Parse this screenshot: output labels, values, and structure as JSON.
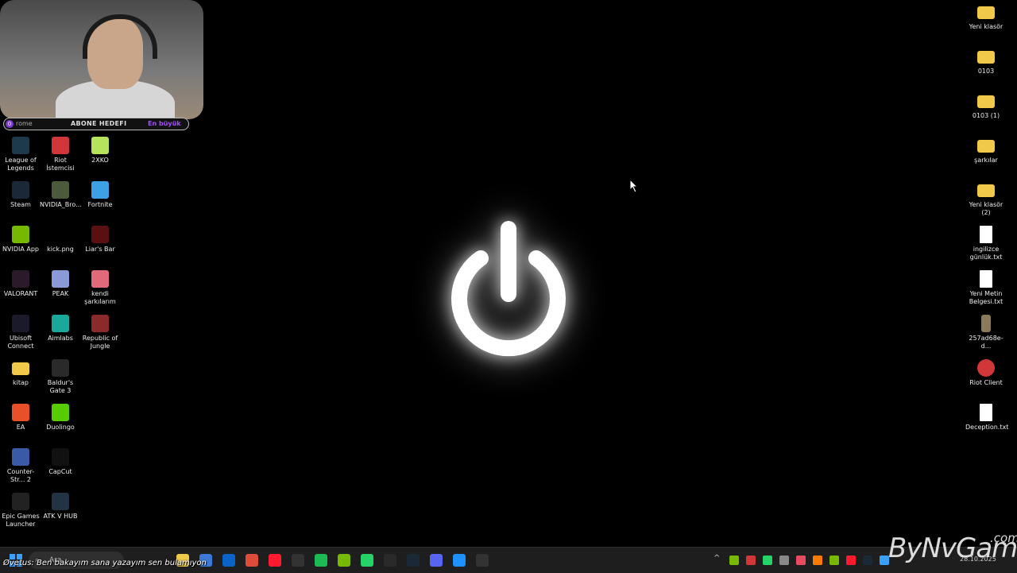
{
  "webcam": {
    "sub_goal": {
      "count": "0",
      "source_text": "rome",
      "title": "ABONE HEDEFI",
      "right_text": "En büyük"
    }
  },
  "desktop_left": [
    {
      "label": "League of Legends",
      "icon": "league-of-legends-icon",
      "color": "#1c3a4a"
    },
    {
      "label": "Riot İstemcisi",
      "icon": "riot-client-icon",
      "color": "#d13639"
    },
    {
      "label": "2XKO",
      "icon": "2xko-icon",
      "color": "#b5e35b"
    },
    {
      "label": "Steam",
      "icon": "steam-icon",
      "color": "#1b2838"
    },
    {
      "label": "NVIDIA_Bro...",
      "icon": "nvidia-broadcast-icon",
      "color": "#4a5a3a"
    },
    {
      "label": "Fortnite",
      "icon": "fortnite-icon",
      "color": "#3ea0e4"
    },
    {
      "label": "NVIDIA App",
      "icon": "nvidia-app-icon",
      "color": "#76b900"
    },
    {
      "label": "kick.png",
      "icon": "kick-icon",
      "color": "#000000"
    },
    {
      "label": "Liar's Bar",
      "icon": "liars-bar-icon",
      "color": "#5a1010"
    },
    {
      "label": "VALORANT",
      "icon": "valorant-icon",
      "color": "#2a1a2a"
    },
    {
      "label": "PEAK",
      "icon": "peak-icon",
      "color": "#8a9ad6"
    },
    {
      "label": "kendi şarkılarım",
      "icon": "music-icon",
      "color": "#e06a7a"
    },
    {
      "label": "Ubisoft Connect",
      "icon": "ubisoft-icon",
      "color": "#1a1a2a"
    },
    {
      "label": "Aimlabs",
      "icon": "aimlabs-icon",
      "color": "#1aa89a"
    },
    {
      "label": "Republic of Jungle",
      "icon": "republic-of-jungle-icon",
      "color": "#8a2a2a"
    },
    {
      "label": "kitap",
      "icon": "folder-icon",
      "color": "#f0c94a"
    },
    {
      "label": "Baldur's Gate 3",
      "icon": "baldurs-gate-icon",
      "color": "#2a2a2a"
    },
    {
      "label": "EA",
      "icon": "ea-icon",
      "color": "#e8502a"
    },
    {
      "label": "Duolingo",
      "icon": "duolingo-icon",
      "color": "#58cc02"
    },
    {
      "label": "Counter-Str... 2",
      "icon": "counter-strike-icon",
      "color": "#3a5aa8"
    },
    {
      "label": "CapCut",
      "icon": "capcut-icon",
      "color": "#111111"
    },
    {
      "label": "Epic Games Launcher",
      "icon": "epic-games-icon",
      "color": "#222222"
    },
    {
      "label": "ATK V HUB",
      "icon": "atk-hub-icon",
      "color": "#223344"
    }
  ],
  "desktop_right": [
    {
      "label": "Yeni klasör",
      "icon": "folder-icon",
      "kind": "folder"
    },
    {
      "label": "0103",
      "icon": "folder-icon",
      "kind": "folder"
    },
    {
      "label": "0103 (1)",
      "icon": "folder-icon",
      "kind": "folder"
    },
    {
      "label": "şarkılar",
      "icon": "folder-icon",
      "kind": "folder"
    },
    {
      "label": "Yeni klasör (2)",
      "icon": "folder-icon",
      "kind": "folder"
    },
    {
      "label": "ingilizce günlük.txt",
      "icon": "text-file-icon",
      "kind": "doc"
    },
    {
      "label": "Yeni Metin Belgesi.txt",
      "icon": "text-file-icon",
      "kind": "doc"
    },
    {
      "label": "257ad68e-d...",
      "icon": "image-file-icon",
      "kind": "image"
    },
    {
      "label": "Riot Client",
      "icon": "riot-client-icon",
      "kind": "riot"
    },
    {
      "label": "Deception.txt",
      "icon": "text-file-icon",
      "kind": "doc"
    }
  ],
  "taskbar": {
    "search_placeholder": "Ara",
    "ticker": "Øvetus: Ben bakayım sana yazayım sen bulamıyon",
    "clock_date": "28.10.2025",
    "pinned": [
      {
        "name": "file-explorer-icon",
        "color": "#f0c94a"
      },
      {
        "name": "store-icon",
        "color": "#3a7ad6"
      },
      {
        "name": "outlook-icon",
        "color": "#0a64c8"
      },
      {
        "name": "chrome-icon",
        "color": "#dd4b39"
      },
      {
        "name": "opera-icon",
        "color": "#ff1b2d"
      },
      {
        "name": "obs-icon",
        "color": "#333333"
      },
      {
        "name": "spotify-icon",
        "color": "#1db954"
      },
      {
        "name": "nvidia-icon",
        "color": "#76b900"
      },
      {
        "name": "whatsapp-icon",
        "color": "#25d366"
      },
      {
        "name": "terminal-icon",
        "color": "#2a2a2a"
      },
      {
        "name": "steam-icon",
        "color": "#1b2838"
      },
      {
        "name": "discord-icon",
        "color": "#5865f2"
      },
      {
        "name": "calculator-icon",
        "color": "#1e90ff"
      },
      {
        "name": "epic-games-icon",
        "color": "#333333"
      }
    ]
  },
  "watermark": {
    "brand": "ByNvGame",
    "suffix": ".com"
  }
}
